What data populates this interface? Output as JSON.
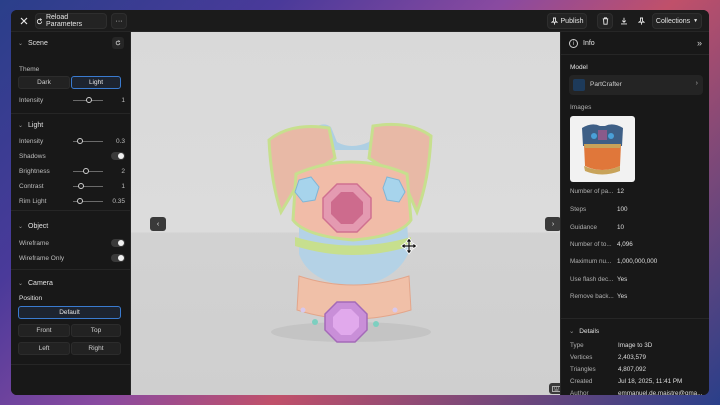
{
  "topbar": {
    "reload_label": "Reload Parameters",
    "more_label": "···",
    "publish_label": "Publish",
    "collections_label": "Collections"
  },
  "left": {
    "scene": {
      "title": "Scene",
      "theme_label": "Theme",
      "theme_options": [
        "Dark",
        "Light"
      ],
      "selected_theme": "Light",
      "intensity_label": "Intensity",
      "intensity_value": "1",
      "intensity_fraction": 0.55
    },
    "light": {
      "title": "Light",
      "rows": [
        {
          "label": "Intensity",
          "value": "0.3",
          "type": "slider",
          "fraction": 0.15
        },
        {
          "label": "Shadows",
          "type": "toggle"
        },
        {
          "label": "Brightness",
          "value": "2",
          "type": "slider",
          "fraction": 0.4
        },
        {
          "label": "Contrast",
          "value": "1",
          "type": "slider",
          "fraction": 0.2
        },
        {
          "label": "Rim Light",
          "value": "0.35",
          "type": "slider",
          "fraction": 0.18
        }
      ]
    },
    "object": {
      "title": "Object",
      "rows": [
        {
          "label": "Wireframe"
        },
        {
          "label": "Wireframe Only"
        }
      ]
    },
    "camera": {
      "title": "Camera",
      "position_label": "Position",
      "default_label": "Default",
      "buttons": [
        "Front",
        "Top",
        "Left",
        "Right"
      ]
    }
  },
  "right": {
    "info_title": "Info",
    "model_label": "Model",
    "model_name": "PartCrafter",
    "images_label": "Images",
    "params": [
      {
        "label": "Number of pa...",
        "value": "12"
      },
      {
        "label": "Steps",
        "value": "100"
      },
      {
        "label": "Guidance",
        "value": "10"
      },
      {
        "label": "Number of to...",
        "value": "4,096"
      },
      {
        "label": "Maximum nu...",
        "value": "1,000,000,000"
      },
      {
        "label": "Use flash dec...",
        "value": "Yes"
      },
      {
        "label": "Remove back...",
        "value": "Yes"
      }
    ],
    "details_title": "Details",
    "details": [
      {
        "label": "Type",
        "value": "Image to 3D"
      },
      {
        "label": "Vertices",
        "value": "2,403,579"
      },
      {
        "label": "Triangles",
        "value": "4,807,092"
      },
      {
        "label": "Created",
        "value": "Jul 18, 2025, 11:41 PM"
      },
      {
        "label": "Author",
        "value": "emmanuel.de.maistre@gma..."
      }
    ]
  }
}
